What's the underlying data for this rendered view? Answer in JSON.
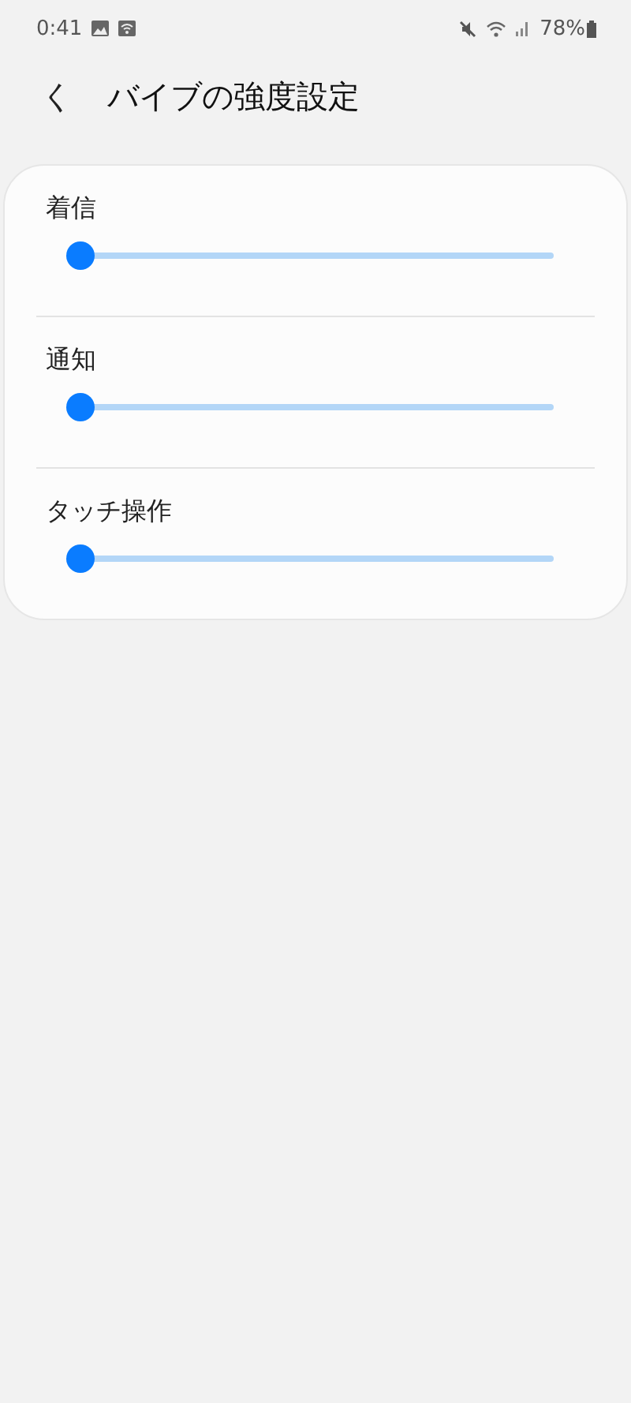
{
  "status_bar": {
    "time": "0:41",
    "battery": "78%"
  },
  "header": {
    "back": "く",
    "title": "バイブの強度設定"
  },
  "sliders": [
    {
      "label": "着信",
      "level": 0
    },
    {
      "label": "通知",
      "level": 0
    },
    {
      "label": "タッチ操作",
      "level": 0
    }
  ]
}
